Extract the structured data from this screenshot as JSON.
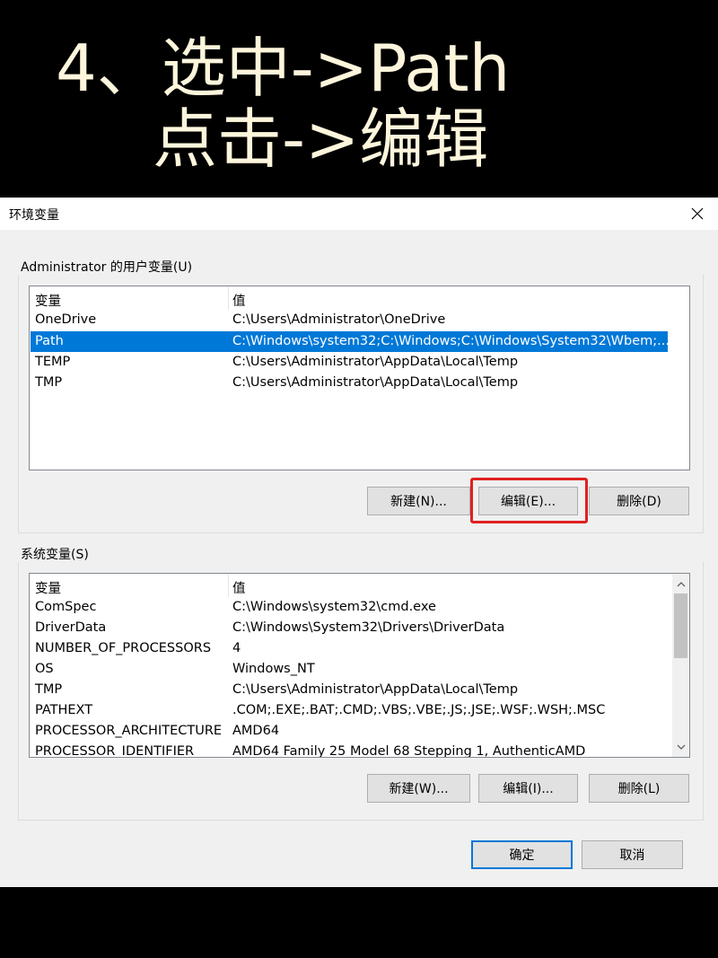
{
  "banner": {
    "line1": "4、选中->Path",
    "line2": "点击->编辑"
  },
  "dialog": {
    "title": "环境变量",
    "close_icon": "close-icon"
  },
  "user_vars": {
    "group_label": "Administrator 的用户变量(U)",
    "headers": {
      "name": "变量",
      "value": "值"
    },
    "rows": [
      {
        "name": "OneDrive",
        "value": "C:\\Users\\Administrator\\OneDrive",
        "selected": false
      },
      {
        "name": "Path",
        "value": "C:\\Windows\\system32;C:\\Windows;C:\\Windows\\System32\\Wbem;...",
        "selected": true
      },
      {
        "name": "TEMP",
        "value": "C:\\Users\\Administrator\\AppData\\Local\\Temp",
        "selected": false
      },
      {
        "name": "TMP",
        "value": "C:\\Users\\Administrator\\AppData\\Local\\Temp",
        "selected": false
      }
    ],
    "buttons": {
      "new": "新建(N)...",
      "edit": "编辑(E)...",
      "delete": "删除(D)"
    }
  },
  "system_vars": {
    "group_label": "系统变量(S)",
    "headers": {
      "name": "变量",
      "value": "值"
    },
    "rows": [
      {
        "name": "ComSpec",
        "value": "C:\\Windows\\system32\\cmd.exe"
      },
      {
        "name": "DriverData",
        "value": "C:\\Windows\\System32\\Drivers\\DriverData"
      },
      {
        "name": "NUMBER_OF_PROCESSORS",
        "value": "4"
      },
      {
        "name": "OS",
        "value": "Windows_NT"
      },
      {
        "name": "TMP",
        "value": "C:\\Users\\Administrator\\AppData\\Local\\Temp"
      },
      {
        "name": "PATHEXT",
        "value": ".COM;.EXE;.BAT;.CMD;.VBS;.VBE;.JS;.JSE;.WSF;.WSH;.MSC"
      },
      {
        "name": "PROCESSOR_ARCHITECTURE",
        "value": "AMD64"
      },
      {
        "name": "PROCESSOR_IDENTIFIER",
        "value": "AMD64 Family 25 Model 68 Stepping 1, AuthenticAMD"
      }
    ],
    "buttons": {
      "new": "新建(W)...",
      "edit": "编辑(I)...",
      "delete": "删除(L)"
    }
  },
  "footer": {
    "ok": "确定",
    "cancel": "取消"
  },
  "colors": {
    "selection": "#0078d7",
    "highlight_box": "#e02020",
    "banner_text": "#fdf6dc"
  }
}
